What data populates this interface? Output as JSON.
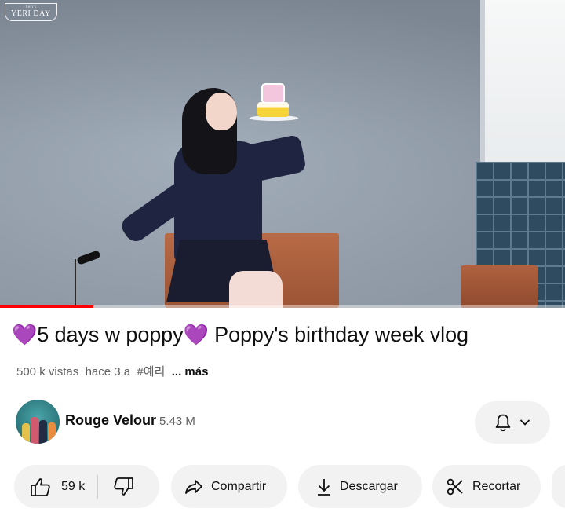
{
  "video": {
    "watermark_small": "Yeri's",
    "watermark_text": "YERI DAY",
    "progress_percent": 16.5
  },
  "title": {
    "heart_left": "💜",
    "part1": "5 days w poppy",
    "heart_right": "💜",
    "part2": " Poppy's birthday week vlog"
  },
  "meta": {
    "views": "500 k vistas",
    "age": "hace 3 a",
    "hashtag": "#예리",
    "more": "... más"
  },
  "channel": {
    "name": "Rouge Velour",
    "subscribers": "5.43 M"
  },
  "actions": {
    "like_count": "59 k",
    "share_label": "Compartir",
    "download_label": "Descargar",
    "clip_label": "Recortar"
  },
  "icons": {
    "like": "thumbs-up-icon",
    "dislike": "thumbs-down-icon",
    "share": "share-arrow-icon",
    "download": "download-icon",
    "clip": "scissors-icon",
    "bell": "bell-icon",
    "chevron": "chevron-down-icon"
  },
  "colors": {
    "accent": "#ff0000",
    "heart": "#8b3fd6",
    "pill_bg": "#f2f2f2"
  }
}
